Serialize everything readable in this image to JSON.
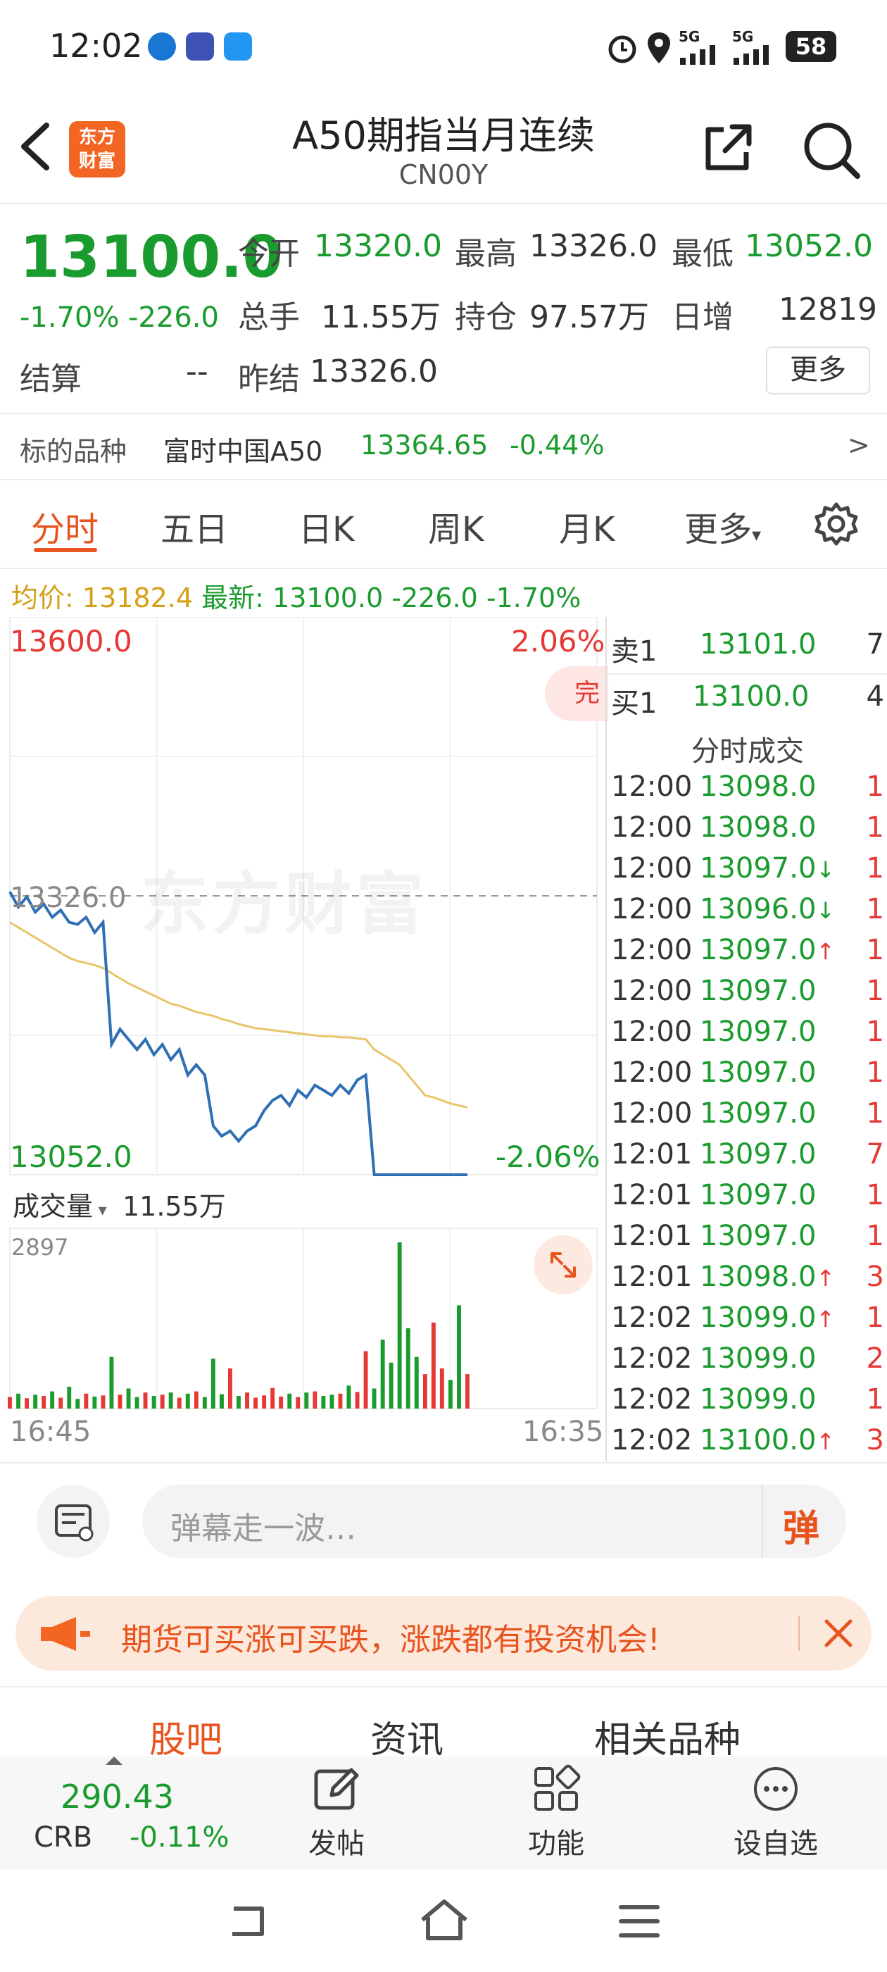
{
  "status_bar": {
    "time": "12:02",
    "battery": "58",
    "net1": "5G",
    "net2": "5G"
  },
  "header": {
    "title": "A50期指当月连续",
    "code": "CN00Y",
    "logo_line1": "东方",
    "logo_line2": "财富"
  },
  "quote": {
    "price": "13100.0",
    "change_pct": "-1.70%",
    "change": "-226.0",
    "open_label": "今开",
    "open": "13320.0",
    "high_label": "最高",
    "high": "13326.0",
    "low_label": "最低",
    "low": "13052.0",
    "volume_label": "总手",
    "volume": "11.55万",
    "oi_label": "持仓",
    "oi": "97.57万",
    "daily_inc_label": "日增",
    "daily_inc": "12819",
    "settle_label": "结算",
    "settle": "--",
    "prev_settle_label": "昨结",
    "prev_settle": "13326.0",
    "more": "更多"
  },
  "underlying": {
    "label": "标的品种",
    "name": "富时中国A50",
    "price": "13364.65",
    "change": "-0.44%",
    "arrow": ">"
  },
  "tabs": [
    {
      "label": "分时"
    },
    {
      "label": "五日"
    },
    {
      "label": "日K"
    },
    {
      "label": "周K"
    },
    {
      "label": "月K"
    },
    {
      "label": "更多"
    }
  ],
  "info_line": {
    "avg_label": "均价:",
    "avg": "13182.4",
    "latest_label": "最新:",
    "latest": "13100.0",
    "chg": "-226.0",
    "pct": "-1.70%"
  },
  "chart_labels": {
    "top_price": "13600.0",
    "top_pct": "2.06%",
    "prev_close": "13326.0",
    "bottom_price": "13052.0",
    "bottom_pct": "-2.06%",
    "done_badge": "完",
    "watermark": "东方财富",
    "vol_selector": "成交量",
    "vol_total": "11.55万",
    "vol_max": "2897",
    "time_start": "16:45",
    "time_end": "16:35"
  },
  "chart_data": {
    "type": "line",
    "title": "",
    "ylim": [
      13052.0,
      13600.0
    ],
    "reference": 13326.0,
    "series": [
      {
        "name": "",
        "values": [
          13330,
          13315,
          13325,
          13310,
          13318,
          13305,
          13312,
          13300,
          13298,
          13305,
          13290,
          13300,
          13180,
          13195,
          13185,
          13175,
          13185,
          13170,
          13180,
          13165,
          13175,
          13150,
          13160,
          13150,
          13100,
          13090,
          13095,
          13085,
          13095,
          13100,
          13115,
          13125,
          13130,
          13120,
          13135,
          13128,
          13140,
          13135,
          13130,
          13140,
          13132,
          13145,
          13150,
          12995,
          12900,
          12820,
          12740,
          12700,
          12670,
          12690,
          12720,
          12740,
          12710,
          12690,
          12700
        ]
      },
      {
        "name": "",
        "values": [
          13300,
          13295,
          13290,
          13285,
          13280,
          13275,
          13270,
          13265,
          13262,
          13260,
          13258,
          13255,
          13250,
          13245,
          13240,
          13236,
          13232,
          13228,
          13224,
          13220,
          13218,
          13215,
          13212,
          13210,
          13208,
          13205,
          13203,
          13200,
          13198,
          13196,
          13195,
          13194,
          13193,
          13192,
          13191,
          13190,
          13189,
          13188,
          13188,
          13187,
          13187,
          13186,
          13185,
          13175,
          13170,
          13165,
          13160,
          13150,
          13140,
          13130,
          13128,
          13125,
          13122,
          13120,
          13118
        ]
      }
    ],
    "volume": [
      200,
      260,
      180,
      240,
      220,
      300,
      190,
      380,
      170,
      260,
      210,
      230,
      900,
      240,
      350,
      200,
      280,
      220,
      240,
      280,
      190,
      260,
      300,
      200,
      870,
      250,
      700,
      220,
      280,
      190,
      230,
      360,
      210,
      260,
      200,
      280,
      300,
      220,
      240,
      260,
      400,
      290,
      1000,
      350,
      1200,
      800,
      2897,
      1400,
      900,
      600,
      1500,
      700,
      500,
      1800,
      600
    ]
  },
  "trades": {
    "sell1_label": "卖1",
    "sell1_price": "13101.0",
    "sell1_qty": "7",
    "buy1_label": "买1",
    "buy1_price": "13100.0",
    "buy1_qty": "4",
    "header": "分时成交",
    "rows": [
      {
        "time": "12:00",
        "price": "13098.0",
        "dir": "",
        "qty": "1"
      },
      {
        "time": "12:00",
        "price": "13098.0",
        "dir": "",
        "qty": "1"
      },
      {
        "time": "12:00",
        "price": "13097.0",
        "dir": "↓",
        "qty": "1"
      },
      {
        "time": "12:00",
        "price": "13096.0",
        "dir": "↓",
        "qty": "1"
      },
      {
        "time": "12:00",
        "price": "13097.0",
        "dir": "↑",
        "qty": "1"
      },
      {
        "time": "12:00",
        "price": "13097.0",
        "dir": "",
        "qty": "1"
      },
      {
        "time": "12:00",
        "price": "13097.0",
        "dir": "",
        "qty": "1"
      },
      {
        "time": "12:00",
        "price": "13097.0",
        "dir": "",
        "qty": "1"
      },
      {
        "time": "12:00",
        "price": "13097.0",
        "dir": "",
        "qty": "1"
      },
      {
        "time": "12:01",
        "price": "13097.0",
        "dir": "",
        "qty": "7"
      },
      {
        "time": "12:01",
        "price": "13097.0",
        "dir": "",
        "qty": "1"
      },
      {
        "time": "12:01",
        "price": "13097.0",
        "dir": "",
        "qty": "1"
      },
      {
        "time": "12:01",
        "price": "13098.0",
        "dir": "↑",
        "qty": "3"
      },
      {
        "time": "12:02",
        "price": "13099.0",
        "dir": "↑",
        "qty": "1"
      },
      {
        "time": "12:02",
        "price": "13099.0",
        "dir": "",
        "qty": "2"
      },
      {
        "time": "12:02",
        "price": "13099.0",
        "dir": "",
        "qty": "1"
      },
      {
        "time": "12:02",
        "price": "13100.0",
        "dir": "↑",
        "qty": "3"
      }
    ]
  },
  "comment": {
    "placeholder": "弹幕走一波…",
    "danmu_btn": "弹"
  },
  "banner": {
    "text": "期货可买涨可买跌，涨跌都有投资机会!"
  },
  "section_tabs": [
    {
      "label": "股吧"
    },
    {
      "label": "资讯"
    },
    {
      "label": "相关品种"
    }
  ],
  "bottom_bar": {
    "crb_value": "290.43",
    "crb_label": "CRB",
    "crb_change": "-0.11%",
    "post": "发帖",
    "function": "功能",
    "watchlist": "设自选"
  },
  "colors": {
    "up": "#e53935",
    "down": "#1a9b2e",
    "accent": "#ff6a00",
    "price_line": "#2f6fb3",
    "avg_line": "#e8c56a"
  }
}
